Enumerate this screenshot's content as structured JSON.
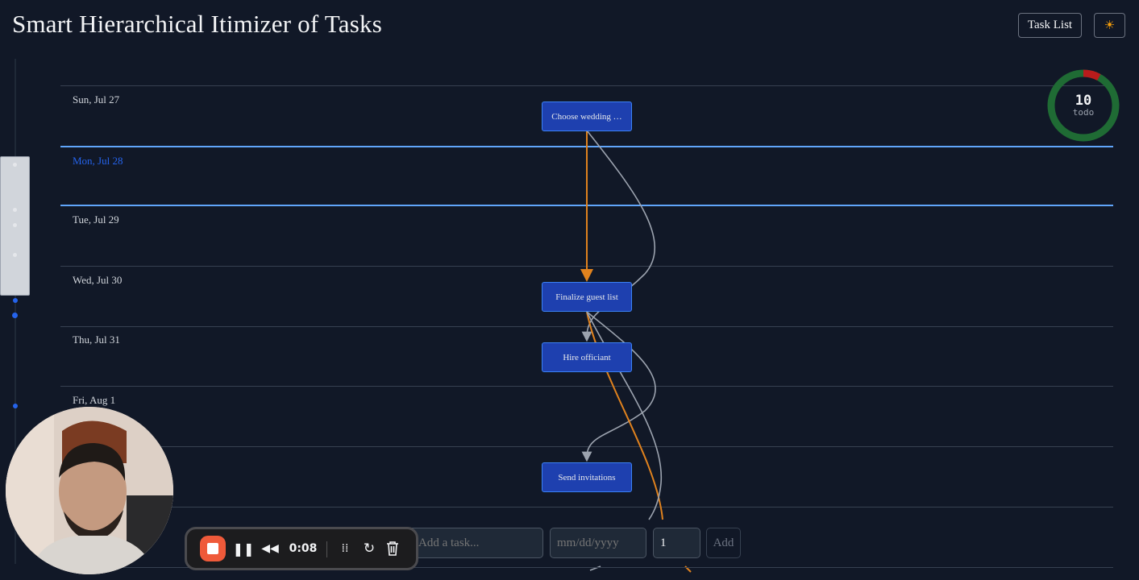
{
  "header": {
    "title": "Smart Hierarchical Itimizer of Tasks",
    "task_list_label": "Task List",
    "theme_icon": "sun-icon",
    "theme_glyph": "☀"
  },
  "days": [
    {
      "label": "Sun, Jul 27",
      "today": false
    },
    {
      "label": "Mon, Jul 28",
      "today": true
    },
    {
      "label": "Tue, Jul 29",
      "today": false
    },
    {
      "label": "Wed, Jul 30",
      "today": false
    },
    {
      "label": "Thu, Jul 31",
      "today": false
    },
    {
      "label": "Fri, Aug 1",
      "today": false
    }
  ],
  "tasks": [
    {
      "label": "Choose wedding …"
    },
    {
      "label": "Finalize guest list"
    },
    {
      "label": "Hire officiant"
    },
    {
      "label": "Send invitations"
    }
  ],
  "summary": {
    "count": "10",
    "label": "todo",
    "done_fraction": 0.08,
    "colors": {
      "todo": "#1f6b34",
      "late": "#b91c1c"
    }
  },
  "add_bar": {
    "task_placeholder": "Add a task...",
    "date_placeholder": "mm/dd/yyyy",
    "quantity_value": "1",
    "add_label": "Add"
  },
  "recorder": {
    "time": "0:08",
    "pause_glyph": "❚❚",
    "rewind_glyph": "◀◀",
    "grid_glyph": "⁞⁞",
    "restart_glyph": "↻"
  },
  "colors": {
    "background": "#111827",
    "task": "#1e40af",
    "edge_primary": "#e0821e",
    "edge_secondary": "#9ca3af",
    "today_line": "#60a5fa"
  }
}
